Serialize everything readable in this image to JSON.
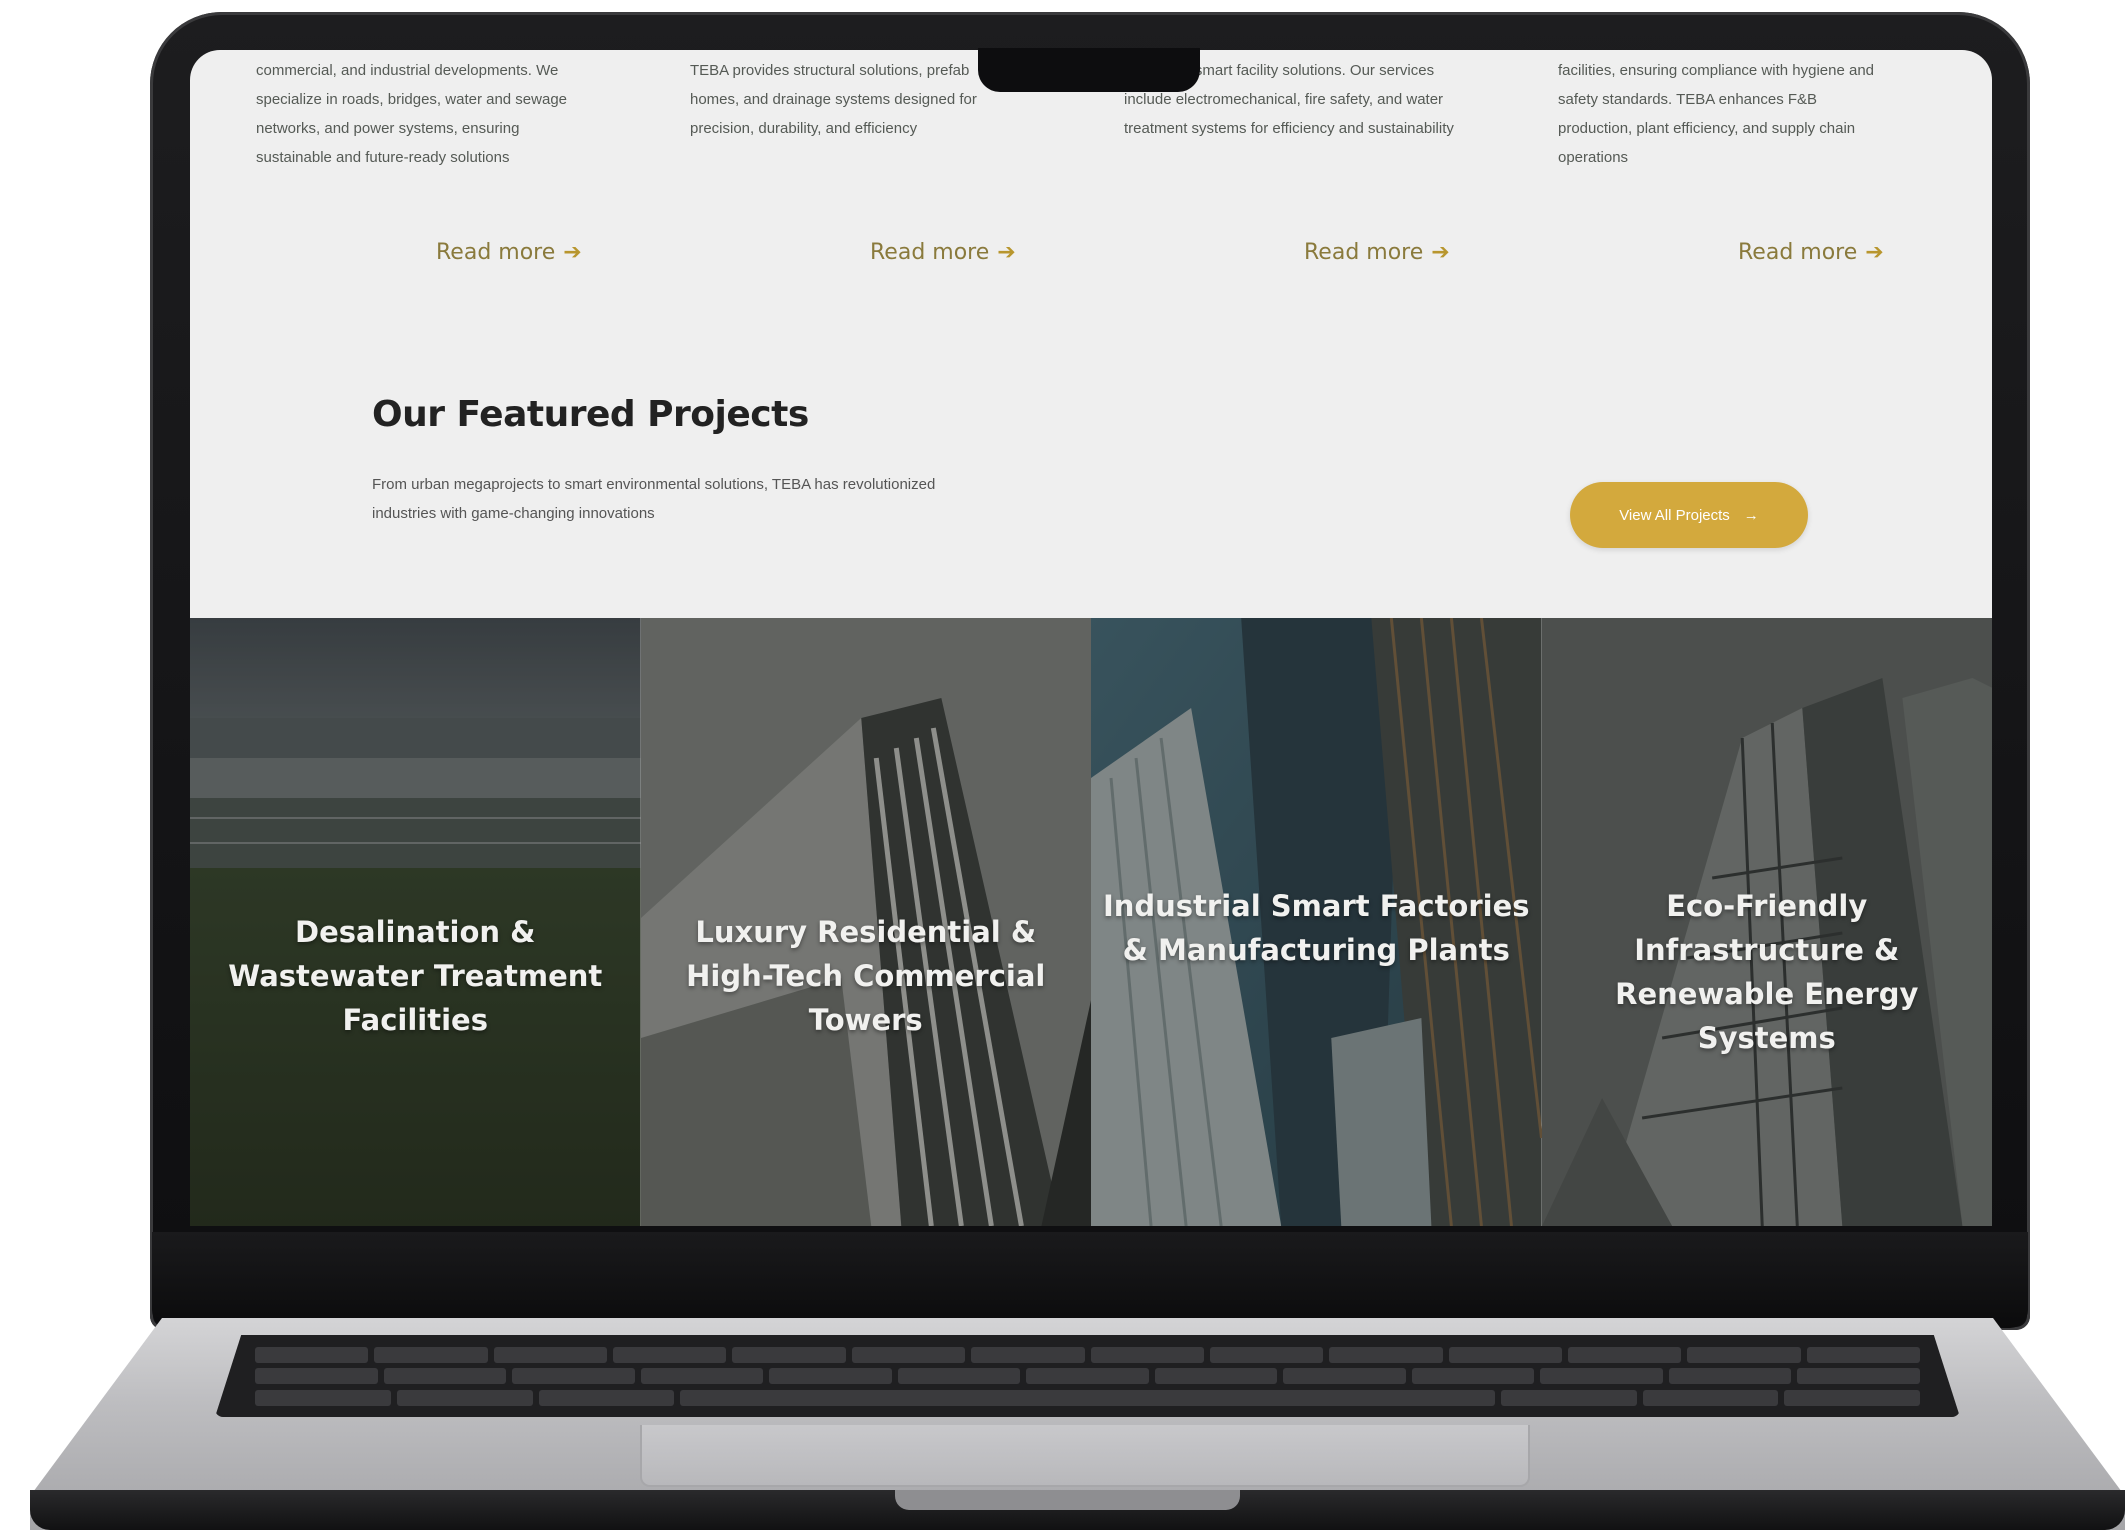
{
  "services": [
    {
      "description": "commercial, and industrial developments. We specialize in roads, bridges, water and sewage networks, and power systems, ensuring sustainable and future-ready solutions",
      "read_more": "Read more"
    },
    {
      "description": "TEBA provides structural solutions, prefab homes, and drainage systems designed for precision, durability, and efficiency",
      "read_more": "Read more"
    },
    {
      "description": "ment, and smart facility solutions. Our services include electromechanical, fire safety, and water treatment systems for efficiency and sustainability",
      "read_more": "Read more"
    },
    {
      "description": "facilities, ensuring compliance with hygiene and safety standards. TEBA enhances F&B production, plant efficiency, and supply chain operations",
      "read_more": "Read more"
    }
  ],
  "featured": {
    "title": "Our Featured Projects",
    "subtitle": "From urban megaprojects to smart environmental solutions, TEBA has revolutionized industries with game-changing innovations",
    "button_label": "View All Projects",
    "button_arrow": "→"
  },
  "projects": [
    {
      "title": "Desalination & Wastewater Treatment Facilities"
    },
    {
      "title": "Luxury Residential & High-Tech Commercial Towers"
    },
    {
      "title": "Industrial Smart Factories & Manufacturing Plants"
    },
    {
      "title": "Eco-Friendly Infrastructure & Renewable Energy Systems"
    }
  ],
  "icons": {
    "read_more_arrow": "arrow-right-icon"
  },
  "colors": {
    "accent": "#d3a93d",
    "read_more": "#8a7a3c",
    "page_bg": "#efefef"
  }
}
